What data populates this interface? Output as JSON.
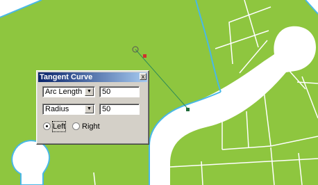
{
  "map": {
    "land_color": "#8ec63f",
    "road_color": "#ffffff",
    "edge_color": "#49b8e6",
    "parcel_line_color": "#ffffff",
    "construction_line_color": "#2e8b57",
    "start_point_color": "#d0312d",
    "end_point_color": "#1f6b3a"
  },
  "dialog": {
    "title": "Tangent Curve",
    "close_glyph": "x",
    "row1": {
      "type": "Arc Length",
      "value": "50"
    },
    "row2": {
      "type": "Radius",
      "value": "50"
    },
    "radio_left": {
      "label": "Left",
      "checked": true
    },
    "radio_right": {
      "label": "Right",
      "checked": false
    },
    "dropdown_glyph": "▼"
  }
}
